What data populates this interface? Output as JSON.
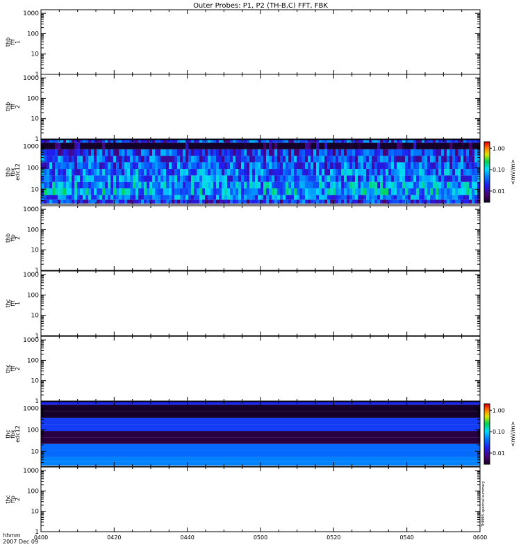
{
  "title": "Outer Probes: P1, P2 (TH-B,C) FFT, FBK",
  "footer": {
    "time_label": "hhmm",
    "date_label": "2007 Dec 09",
    "side_text": "THEMIS spectral summary"
  },
  "colors": {
    "axis": "#000000",
    "background": "#ffffff"
  },
  "chart_data": [
    {
      "type": "heatmap",
      "name": "thb_fff_1",
      "ylabel_lines": [
        "thb",
        "fff",
        "1"
      ],
      "yscale": "log",
      "ylim": [
        1,
        1500
      ],
      "y_ticks": [
        1,
        10,
        100,
        1000
      ],
      "y_tick_labels": [
        "1",
        "10",
        "100",
        "1000"
      ],
      "x_ticks": [
        "0400",
        "0420",
        "0440",
        "0500",
        "0520",
        "0540",
        "0600"
      ],
      "has_data": false
    },
    {
      "type": "heatmap",
      "name": "thb_fff_2",
      "ylabel_lines": [
        "thb",
        "fff",
        "2"
      ],
      "yscale": "log",
      "ylim": [
        1,
        1500
      ],
      "y_ticks": [
        1,
        10,
        100,
        1000
      ],
      "y_tick_labels": [
        "1",
        "10",
        "100",
        "1000"
      ],
      "x_ticks": [
        "0400",
        "0420",
        "0440",
        "0500",
        "0520",
        "0540",
        "0600"
      ],
      "has_data": false
    },
    {
      "type": "heatmap",
      "name": "thb_fbk_edc12",
      "ylabel_lines": [
        "thb",
        "fbk",
        "edc12"
      ],
      "yscale": "log",
      "ylim": [
        2,
        2000
      ],
      "y_ticks": [
        10,
        100,
        1000
      ],
      "y_tick_labels": [
        "10",
        "100",
        "1000"
      ],
      "x_ticks": [
        "0400",
        "0420",
        "0440",
        "0500",
        "0520",
        "0540",
        "0600"
      ],
      "has_data": true,
      "variable": true,
      "band_edges": [
        2.2,
        3.3,
        5.4,
        11,
        22,
        44,
        88,
        180,
        360,
        720,
        1450,
        2000
      ],
      "band_levels": [
        0.02,
        0.04,
        0.07,
        0.055,
        0.045,
        0.04,
        0.032,
        0.028,
        0.022,
        0.004,
        0.025
      ],
      "colorbar": {
        "label": "<mV/m>",
        "ticks": [
          "1.00",
          "0.10",
          "0.01"
        ],
        "range": [
          0.003,
          2.0
        ],
        "scale": "log"
      }
    },
    {
      "type": "heatmap",
      "name": "thb_ffp_2",
      "ylabel_lines": [
        "thb",
        "ffp",
        "2"
      ],
      "yscale": "log",
      "ylim": [
        1,
        1500
      ],
      "y_ticks": [
        1,
        10,
        100,
        1000
      ],
      "y_tick_labels": [
        "1",
        "10",
        "100",
        "1000"
      ],
      "x_ticks": [
        "0400",
        "0420",
        "0440",
        "0500",
        "0520",
        "0540",
        "0600"
      ],
      "has_data": false
    },
    {
      "type": "heatmap",
      "name": "thc_fff_1",
      "ylabel_lines": [
        "thc",
        "fff",
        "1"
      ],
      "yscale": "log",
      "ylim": [
        1,
        1500
      ],
      "y_ticks": [
        1,
        10,
        100,
        1000
      ],
      "y_tick_labels": [
        "1",
        "10",
        "100",
        "1000"
      ],
      "x_ticks": [
        "0400",
        "0420",
        "0440",
        "0500",
        "0520",
        "0540",
        "0600"
      ],
      "has_data": false
    },
    {
      "type": "heatmap",
      "name": "thc_fff_2",
      "ylabel_lines": [
        "thc",
        "fff",
        "2"
      ],
      "yscale": "log",
      "ylim": [
        1,
        1500
      ],
      "y_ticks": [
        1,
        10,
        100,
        1000
      ],
      "y_tick_labels": [
        "1",
        "10",
        "100",
        "1000"
      ],
      "x_ticks": [
        "0400",
        "0420",
        "0440",
        "0500",
        "0520",
        "0540",
        "0600"
      ],
      "has_data": false
    },
    {
      "type": "heatmap",
      "name": "thc_fbk_edc12",
      "ylabel_lines": [
        "thc",
        "fbk",
        "edc12"
      ],
      "yscale": "log",
      "ylim": [
        2,
        2000
      ],
      "y_ticks": [
        10,
        100,
        1000
      ],
      "y_tick_labels": [
        "10",
        "100",
        "1000"
      ],
      "x_ticks": [
        "0400",
        "0420",
        "0440",
        "0500",
        "0520",
        "0540",
        "0600"
      ],
      "has_data": true,
      "variable": false,
      "band_edges": [
        2.2,
        3.3,
        5.4,
        11,
        22,
        44,
        88,
        180,
        360,
        720,
        1450,
        2000
      ],
      "band_levels": [
        0.05,
        0.05,
        0.04,
        0.04,
        0.004,
        0.004,
        0.025,
        0.025,
        0.002,
        0.002,
        0.02
      ],
      "colorbar": {
        "label": "<mV/m>",
        "ticks": [
          "1.00",
          "0.10",
          "0.01"
        ],
        "range": [
          0.003,
          2.0
        ],
        "scale": "log"
      }
    },
    {
      "type": "heatmap",
      "name": "thc_ffp_2",
      "ylabel_lines": [
        "thc",
        "ffp",
        "2"
      ],
      "yscale": "log",
      "ylim": [
        1,
        1500
      ],
      "y_ticks": [
        1,
        10,
        100,
        1000
      ],
      "y_tick_labels": [
        "1",
        "10",
        "100",
        "1000"
      ],
      "x_ticks": [
        "0400",
        "0420",
        "0440",
        "0500",
        "0520",
        "0540",
        "0600"
      ],
      "has_data": false
    }
  ]
}
